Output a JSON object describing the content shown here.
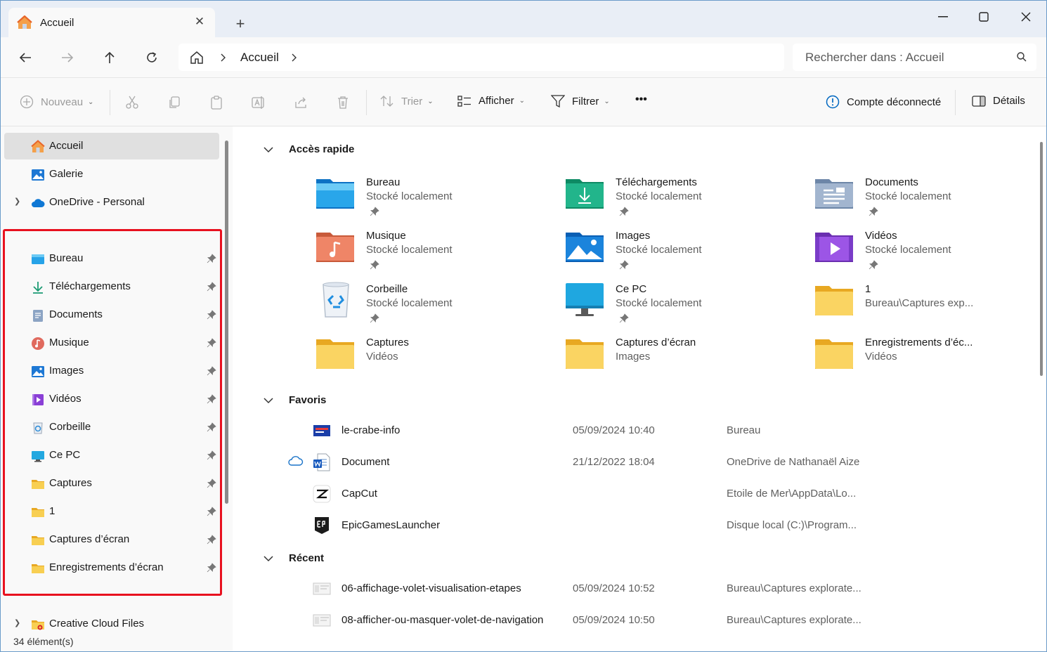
{
  "window": {
    "tab_title": "Accueil",
    "new_tab": "+"
  },
  "address": {
    "crumb": "Accueil",
    "search_placeholder": "Rechercher dans : Accueil"
  },
  "commands": {
    "new": "Nouveau",
    "sort": "Trier",
    "view": "Afficher",
    "filter": "Filtrer",
    "more": "•••",
    "account": "Compte déconnecté",
    "details": "Détails"
  },
  "sidebar": {
    "top": [
      {
        "label": "Accueil",
        "icon": "home-icon"
      },
      {
        "label": "Galerie",
        "icon": "gallery-icon"
      },
      {
        "label": "OneDrive - Personal",
        "icon": "onedrive-icon"
      }
    ],
    "pinned": [
      {
        "label": "Bureau",
        "icon": "desktop-folder-icon"
      },
      {
        "label": "Téléchargements",
        "icon": "downloads-icon"
      },
      {
        "label": "Documents",
        "icon": "documents-icon"
      },
      {
        "label": "Musique",
        "icon": "music-icon"
      },
      {
        "label": "Images",
        "icon": "pictures-icon"
      },
      {
        "label": "Vidéos",
        "icon": "videos-icon"
      },
      {
        "label": "Corbeille",
        "icon": "recycle-bin-icon"
      },
      {
        "label": "Ce PC",
        "icon": "this-pc-icon"
      },
      {
        "label": "Captures",
        "icon": "folder-icon"
      },
      {
        "label": "1",
        "icon": "folder-icon"
      },
      {
        "label": "Captures d’écran",
        "icon": "folder-icon"
      },
      {
        "label": "Enregistrements d’écran",
        "icon": "folder-icon"
      }
    ],
    "bottom": [
      {
        "label": "Creative Cloud Files",
        "icon": "creative-cloud-icon"
      }
    ]
  },
  "status": {
    "count": "34 élément(s)"
  },
  "quick_access": {
    "title": "Accès rapide",
    "tiles": [
      {
        "name": "Bureau",
        "sub": "Stocké localement",
        "pinned": true,
        "icon": "desktop-folder-icon"
      },
      {
        "name": "Téléchargements",
        "sub": "Stocké localement",
        "pinned": true,
        "icon": "downloads-icon"
      },
      {
        "name": "Documents",
        "sub": "Stocké localement",
        "pinned": true,
        "icon": "documents-icon"
      },
      {
        "name": "Musique",
        "sub": "Stocké localement",
        "pinned": true,
        "icon": "music-icon"
      },
      {
        "name": "Images",
        "sub": "Stocké localement",
        "pinned": true,
        "icon": "pictures-icon"
      },
      {
        "name": "Vidéos",
        "sub": "Stocké localement",
        "pinned": true,
        "icon": "videos-icon"
      },
      {
        "name": "Corbeille",
        "sub": "Stocké localement",
        "pinned": true,
        "icon": "recycle-bin-icon"
      },
      {
        "name": "Ce PC",
        "sub": "Stocké localement",
        "pinned": true,
        "icon": "this-pc-icon"
      },
      {
        "name": "1",
        "sub": "Bureau\\Captures exp...",
        "pinned": false,
        "icon": "folder-icon"
      },
      {
        "name": "Captures",
        "sub": "Vidéos",
        "pinned": false,
        "icon": "folder-icon"
      },
      {
        "name": "Captures d’écran",
        "sub": "Images",
        "pinned": false,
        "icon": "folder-icon"
      },
      {
        "name": "Enregistrements d’éc...",
        "sub": "Vidéos",
        "pinned": false,
        "icon": "folder-icon"
      }
    ]
  },
  "favorites": {
    "title": "Favoris",
    "rows": [
      {
        "name": "le-crabe-info",
        "date": "05/09/2024 10:40",
        "location": "Bureau",
        "icon": "image-file-icon",
        "cloud": false
      },
      {
        "name": "Document",
        "date": "21/12/2022 18:04",
        "location": "OneDrive de Nathanaël Aize",
        "icon": "word-file-icon",
        "cloud": true
      },
      {
        "name": "CapCut",
        "date": "",
        "location": "Etoile de Mer\\AppData\\Lo...",
        "icon": "capcut-icon",
        "cloud": false
      },
      {
        "name": "EpicGamesLauncher",
        "date": "",
        "location": "Disque local (C:)\\Program...",
        "icon": "epic-games-icon",
        "cloud": false
      }
    ]
  },
  "recent": {
    "title": "Récent",
    "rows": [
      {
        "name": "06-affichage-volet-visualisation-etapes",
        "date": "05/09/2024 10:52",
        "location": "Bureau\\Captures explorate...",
        "icon": "screenshot-file-icon"
      },
      {
        "name": "08-afficher-ou-masquer-volet-de-navigation",
        "date": "05/09/2024 10:50",
        "location": "Bureau\\Captures explorate...",
        "icon": "screenshot-file-icon"
      }
    ]
  },
  "colors": {
    "highlight": "#e8111f",
    "accent": "#0067c0",
    "folder": "#f5c748"
  }
}
